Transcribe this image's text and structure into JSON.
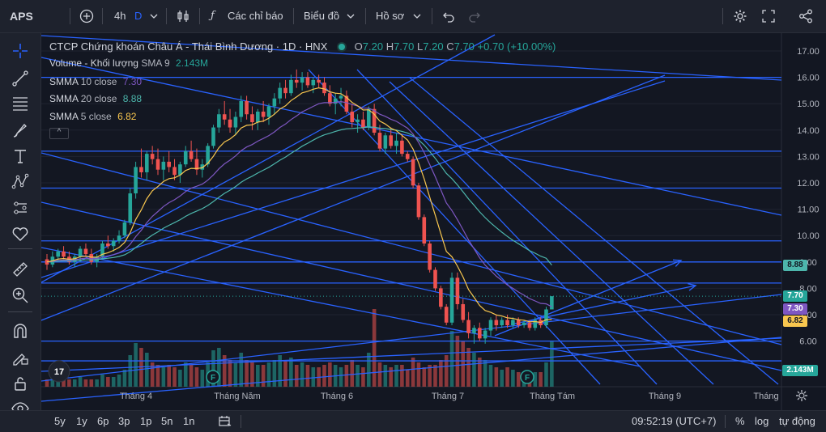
{
  "topbar": {
    "symbol": "APS",
    "interval": "4h",
    "interval_d": "D",
    "indicators_label": "Các chỉ báo",
    "chart_type_label": "Biểu đồ",
    "profile_label": "Hồ sơ"
  },
  "legend": {
    "title": "CTCP Chứng khoán Châu Á - Thái Bình Dương · 1D · HNX",
    "o_label": "O",
    "o": "7.20",
    "h_label": "H",
    "h": "7.70",
    "l_label": "L",
    "l": "7.20",
    "c_label": "C",
    "c": "7.70",
    "change": "+0.70 (+10.00%)",
    "volume_name": "Volume - Khối lượng",
    "volume_param": "SMA 9",
    "volume_value": "2.143M",
    "ind1_name": "SMMA",
    "ind1_param": "10 close",
    "ind1_value": "7.30",
    "ind2_name": "SMMA",
    "ind2_param": "20 close",
    "ind2_value": "8.88",
    "ind3_name": "SMMA",
    "ind3_param": "5 close",
    "ind3_value": "6.82"
  },
  "price_tags": {
    "smma20": "8.88",
    "last": "7.70",
    "smma10": "7.30",
    "smma5": "6.82",
    "volume": "2.143M"
  },
  "bottombar": {
    "ranges": [
      "5y",
      "1y",
      "6p",
      "3p",
      "1p",
      "5n",
      "1n"
    ],
    "time": "09:52:19 (UTC+7)",
    "percent": "%",
    "log": "log",
    "auto": "tự động"
  },
  "colors": {
    "up": "#26a69a",
    "down": "#ef5350",
    "smma10": "#7e57c2",
    "smma20": "#4db6ac",
    "smma5": "#f9c74f",
    "drawing": "#2962ff"
  },
  "chart_data": {
    "type": "candlestick",
    "y_axis_ticks": [
      "17.00",
      "16.00",
      "15.00",
      "14.00",
      "13.00",
      "12.00",
      "11.00",
      "10.00",
      "9.00",
      "8.00",
      "7.00",
      "6.00"
    ],
    "x_axis_labels": [
      "Tháng 4",
      "Tháng Năm",
      "Tháng 6",
      "Tháng 7",
      "Tháng Tám",
      "Tháng 9",
      "Tháng"
    ],
    "ylim": [
      5.5,
      17.3
    ],
    "candles": [
      [
        9.1,
        9.3,
        8.7,
        8.9
      ],
      [
        8.9,
        9.4,
        8.8,
        9.2
      ],
      [
        9.2,
        9.5,
        9.0,
        9.4
      ],
      [
        9.4,
        9.6,
        9.1,
        9.2
      ],
      [
        9.2,
        9.4,
        8.9,
        9.0
      ],
      [
        9.0,
        9.3,
        8.8,
        9.2
      ],
      [
        9.2,
        9.6,
        9.0,
        9.5
      ],
      [
        9.5,
        9.7,
        9.2,
        9.3
      ],
      [
        9.3,
        9.5,
        8.9,
        9.0
      ],
      [
        9.0,
        9.3,
        8.8,
        9.2
      ],
      [
        9.2,
        9.8,
        9.1,
        9.7
      ],
      [
        9.7,
        10.0,
        9.5,
        9.6
      ],
      [
        9.6,
        9.9,
        9.4,
        9.8
      ],
      [
        9.8,
        10.2,
        9.7,
        10.0
      ],
      [
        10.0,
        10.6,
        9.9,
        10.5
      ],
      [
        10.5,
        11.8,
        10.4,
        11.6
      ],
      [
        11.6,
        12.8,
        11.4,
        12.6
      ],
      [
        12.6,
        13.3,
        12.2,
        12.4
      ],
      [
        12.4,
        13.2,
        12.1,
        13.1
      ],
      [
        13.1,
        13.4,
        12.7,
        12.9
      ],
      [
        12.9,
        13.3,
        12.3,
        12.5
      ],
      [
        12.5,
        13.0,
        12.1,
        12.8
      ],
      [
        12.8,
        13.2,
        12.4,
        12.6
      ],
      [
        12.6,
        12.9,
        12.1,
        12.3
      ],
      [
        12.3,
        12.8,
        12.0,
        12.7
      ],
      [
        12.7,
        13.4,
        12.6,
        13.2
      ],
      [
        13.2,
        13.6,
        12.8,
        12.9
      ],
      [
        12.9,
        13.3,
        12.3,
        12.5
      ],
      [
        12.5,
        12.9,
        12.2,
        12.7
      ],
      [
        12.7,
        13.5,
        12.6,
        13.4
      ],
      [
        13.4,
        14.2,
        13.3,
        14.1
      ],
      [
        14.1,
        14.8,
        13.9,
        14.6
      ],
      [
        14.6,
        15.1,
        14.2,
        14.4
      ],
      [
        14.4,
        14.8,
        13.9,
        14.1
      ],
      [
        14.1,
        14.7,
        13.8,
        14.5
      ],
      [
        14.5,
        15.3,
        14.3,
        15.1
      ],
      [
        15.1,
        15.3,
        14.4,
        14.6
      ],
      [
        14.6,
        14.9,
        14.0,
        14.3
      ],
      [
        14.3,
        14.8,
        14.0,
        14.7
      ],
      [
        14.7,
        15.1,
        14.3,
        14.5
      ],
      [
        14.5,
        15.0,
        14.2,
        14.9
      ],
      [
        14.9,
        15.4,
        14.6,
        15.2
      ],
      [
        15.2,
        15.8,
        15.0,
        15.6
      ],
      [
        15.6,
        15.9,
        15.2,
        15.4
      ],
      [
        15.4,
        16.1,
        15.3,
        15.9
      ],
      [
        15.9,
        16.3,
        15.6,
        15.8
      ],
      [
        15.8,
        16.2,
        15.5,
        16.0
      ],
      [
        16.0,
        16.2,
        15.6,
        15.7
      ],
      [
        15.7,
        16.0,
        15.4,
        15.9
      ],
      [
        15.9,
        16.1,
        15.6,
        15.8
      ],
      [
        15.8,
        16.0,
        15.3,
        15.4
      ],
      [
        15.4,
        15.7,
        14.9,
        15.0
      ],
      [
        15.0,
        15.4,
        14.6,
        15.2
      ],
      [
        15.2,
        15.6,
        14.9,
        15.3
      ],
      [
        15.3,
        15.5,
        14.6,
        14.7
      ],
      [
        14.7,
        15.0,
        14.1,
        14.3
      ],
      [
        14.3,
        14.6,
        13.9,
        14.4
      ],
      [
        14.4,
        14.7,
        14.0,
        14.1
      ],
      [
        14.1,
        14.9,
        14.0,
        14.8
      ],
      [
        14.8,
        15.0,
        13.8,
        13.9
      ],
      [
        13.9,
        14.2,
        13.2,
        13.3
      ],
      [
        13.3,
        13.9,
        13.1,
        13.8
      ],
      [
        13.8,
        14.1,
        13.3,
        13.4
      ],
      [
        13.4,
        13.9,
        13.1,
        13.6
      ],
      [
        13.6,
        13.8,
        13.0,
        13.1
      ],
      [
        13.1,
        13.2,
        12.8,
        12.9
      ],
      [
        12.9,
        13.0,
        11.8,
        11.9
      ],
      [
        11.9,
        12.0,
        10.6,
        10.7
      ],
      [
        10.7,
        10.8,
        9.6,
        9.7
      ],
      [
        9.7,
        9.8,
        8.6,
        8.7
      ],
      [
        8.7,
        8.8,
        7.9,
        8.0
      ],
      [
        8.0,
        8.1,
        7.2,
        7.3
      ],
      [
        7.3,
        7.4,
        6.6,
        6.7
      ],
      [
        6.7,
        8.6,
        6.6,
        8.4
      ],
      [
        8.4,
        8.6,
        7.2,
        7.4
      ],
      [
        7.4,
        7.6,
        6.7,
        6.8
      ],
      [
        6.8,
        7.1,
        6.1,
        6.3
      ],
      [
        6.3,
        6.6,
        5.9,
        6.5
      ],
      [
        6.5,
        6.7,
        6.0,
        6.1
      ],
      [
        6.1,
        6.5,
        5.9,
        6.4
      ],
      [
        6.4,
        6.9,
        6.2,
        6.8
      ],
      [
        6.8,
        7.0,
        6.4,
        6.6
      ],
      [
        6.6,
        6.9,
        6.5,
        6.8
      ],
      [
        6.8,
        7.0,
        6.5,
        6.6
      ],
      [
        6.6,
        6.9,
        6.5,
        6.8
      ],
      [
        6.8,
        6.9,
        6.5,
        6.6
      ],
      [
        6.6,
        6.8,
        6.5,
        6.7
      ],
      [
        6.7,
        6.8,
        6.4,
        6.5
      ],
      [
        6.5,
        6.9,
        6.4,
        6.8
      ],
      [
        6.8,
        6.9,
        6.5,
        6.6
      ],
      [
        6.6,
        7.3,
        6.5,
        7.2
      ],
      [
        7.2,
        7.7,
        7.2,
        7.7
      ]
    ],
    "volumes": [
      0.3,
      0.4,
      0.4,
      0.3,
      0.3,
      0.3,
      0.4,
      0.3,
      0.3,
      0.3,
      0.5,
      0.4,
      0.4,
      0.5,
      0.7,
      1.3,
      1.8,
      1.6,
      1.4,
      1.0,
      0.9,
      0.8,
      0.9,
      0.8,
      0.7,
      1.0,
      0.9,
      0.8,
      0.7,
      1.0,
      1.5,
      1.6,
      1.3,
      1.1,
      1.0,
      1.4,
      1.1,
      1.0,
      0.9,
      0.9,
      1.0,
      1.1,
      1.3,
      1.1,
      1.2,
      0.9,
      1.0,
      0.9,
      0.8,
      0.8,
      0.9,
      1.0,
      0.9,
      0.8,
      0.9,
      1.1,
      0.9,
      0.8,
      1.4,
      3.2,
      1.0,
      0.9,
      0.8,
      0.9,
      0.9,
      0.7,
      1.2,
      1.0,
      0.8,
      0.9,
      0.9,
      1.1,
      1.3,
      2.3,
      2.1,
      1.9,
      1.6,
      1.4,
      1.2,
      1.1,
      0.9,
      0.8,
      0.7,
      0.8,
      0.7,
      0.6,
      0.6,
      0.5,
      0.6,
      0.6,
      1.0,
      1.9
    ],
    "smma10": [
      9.0,
      9.02,
      9.06,
      9.07,
      9.07,
      9.08,
      9.12,
      9.14,
      9.12,
      9.13,
      9.19,
      9.23,
      9.28,
      9.35,
      9.46,
      9.67,
      9.96,
      10.2,
      10.49,
      10.73,
      10.91,
      11.1,
      11.25,
      11.36,
      11.5,
      11.67,
      11.8,
      11.87,
      11.95,
      12.1,
      12.3,
      12.53,
      12.72,
      12.86,
      13.02,
      13.22,
      13.36,
      13.45,
      13.58,
      13.68,
      13.79,
      13.93,
      14.1,
      14.23,
      14.4,
      14.54,
      14.69,
      14.79,
      14.9,
      15.0,
      15.04,
      15.04,
      15.05,
      15.08,
      15.04,
      14.97,
      14.91,
      14.83,
      14.83,
      14.74,
      14.6,
      14.52,
      14.41,
      14.33,
      14.2,
      14.07,
      13.85,
      13.53,
      13.15,
      12.7,
      12.23,
      11.74,
      11.24,
      10.95,
      10.6,
      10.22,
      9.83,
      9.5,
      9.16,
      8.88,
      8.67,
      8.46,
      8.3,
      8.13,
      8.0,
      7.86,
      7.74,
      7.61,
      7.52,
      7.43,
      7.41,
      7.3
    ],
    "smma20": [
      9.0,
      9.01,
      9.03,
      9.04,
      9.04,
      9.05,
      9.07,
      9.08,
      9.08,
      9.09,
      9.12,
      9.14,
      9.17,
      9.21,
      9.27,
      9.39,
      9.55,
      9.7,
      9.87,
      10.02,
      10.14,
      10.28,
      10.39,
      10.49,
      10.6,
      10.73,
      10.84,
      10.93,
      11.02,
      11.14,
      11.29,
      11.45,
      11.6,
      11.72,
      11.86,
      12.02,
      12.15,
      12.25,
      12.37,
      12.48,
      12.59,
      12.72,
      12.86,
      12.98,
      13.12,
      13.25,
      13.39,
      13.5,
      13.62,
      13.73,
      13.82,
      13.88,
      13.95,
      14.01,
      14.05,
      14.06,
      14.08,
      14.09,
      14.12,
      14.11,
      14.07,
      14.06,
      14.02,
      14.0,
      13.95,
      13.89,
      13.79,
      13.63,
      13.43,
      13.19,
      12.93,
      12.65,
      12.36,
      12.16,
      11.92,
      11.66,
      11.39,
      11.15,
      10.9,
      10.68,
      10.48,
      10.3,
      10.13,
      9.97,
      9.82,
      9.69,
      9.56,
      9.43,
      9.33,
      9.22,
      9.14,
      8.88
    ],
    "smma5": [
      9.0,
      9.04,
      9.11,
      9.13,
      9.1,
      9.12,
      9.2,
      9.22,
      9.18,
      9.18,
      9.29,
      9.35,
      9.44,
      9.55,
      9.74,
      10.11,
      10.61,
      10.97,
      11.4,
      11.7,
      11.86,
      12.05,
      12.16,
      12.19,
      12.29,
      12.47,
      12.55,
      12.54,
      12.57,
      12.74,
      13.01,
      13.33,
      13.55,
      13.66,
      13.83,
      14.08,
      14.18,
      14.2,
      14.3,
      14.34,
      14.45,
      14.6,
      14.8,
      14.92,
      15.12,
      15.26,
      15.41,
      15.47,
      15.55,
      15.6,
      15.56,
      15.45,
      15.4,
      15.38,
      15.24,
      15.05,
      14.92,
      14.76,
      14.77,
      14.6,
      14.34,
      14.23,
      14.07,
      13.98,
      13.8,
      13.62,
      13.28,
      12.76,
      12.15,
      11.46,
      10.77,
      10.08,
      9.4,
      9.2,
      8.84,
      8.43,
      7.95,
      7.66,
      7.35,
      7.16,
      7.09,
      6.99,
      6.95,
      6.88,
      6.86,
      6.81,
      6.79,
      6.73,
      6.74,
      6.71,
      6.81,
      6.82
    ]
  }
}
